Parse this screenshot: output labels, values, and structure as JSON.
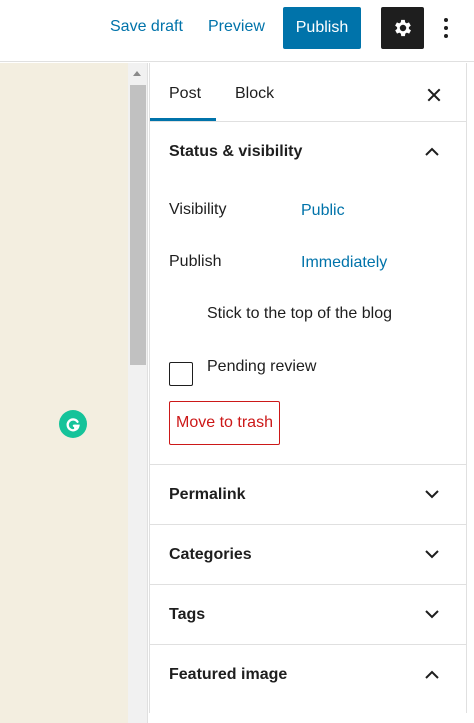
{
  "toolbar": {
    "save_draft_label": "Save draft",
    "preview_label": "Preview",
    "publish_label": "Publish"
  },
  "sidebar": {
    "tabs": [
      {
        "label": "Post",
        "active": true
      },
      {
        "label": "Block",
        "active": false
      }
    ],
    "status_visibility": {
      "title": "Status & visibility",
      "expanded": true,
      "visibility_label": "Visibility",
      "visibility_value": "Public",
      "publish_label": "Publish",
      "publish_value": "Immediately",
      "stick_to_top_label": "Stick to the top of the blog",
      "stick_to_top_checked": false,
      "pending_review_label": "Pending review",
      "pending_review_checked": false,
      "move_to_trash_label": "Move to trash"
    },
    "panels": [
      {
        "title": "Permalink",
        "expanded": false
      },
      {
        "title": "Categories",
        "expanded": false
      },
      {
        "title": "Tags",
        "expanded": false
      },
      {
        "title": "Featured image",
        "expanded": true
      }
    ]
  },
  "colors": {
    "accent": "#0073aa",
    "danger": "#cc1818",
    "canvas_bg": "#f3eee0",
    "grammarly": "#15c39a"
  }
}
